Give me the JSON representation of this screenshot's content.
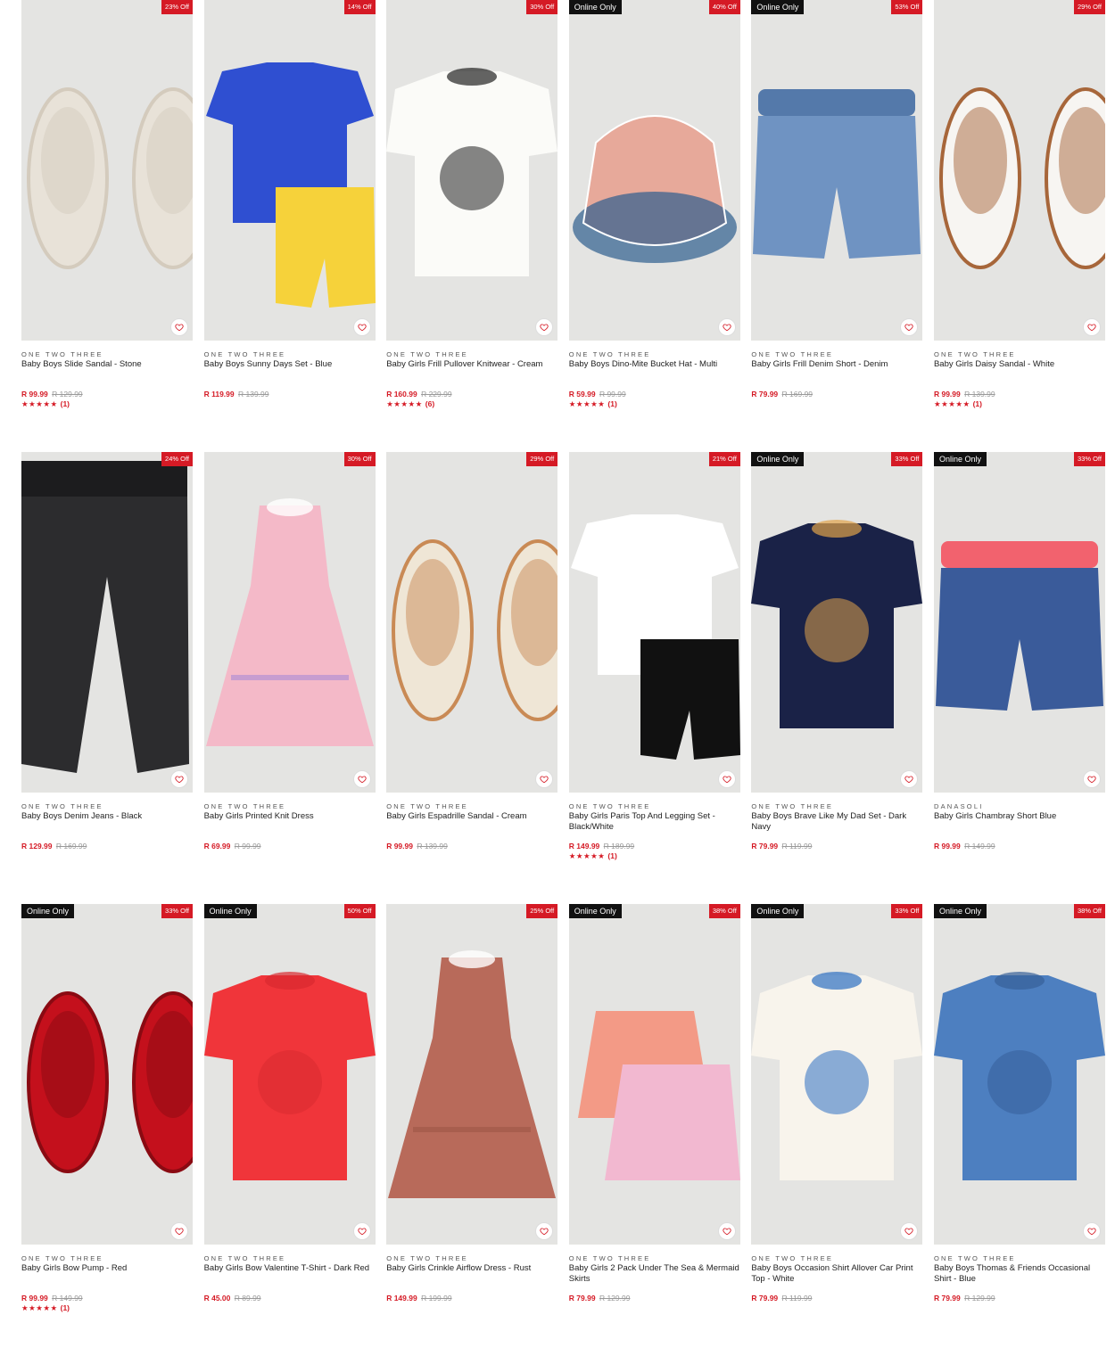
{
  "products": [
    {
      "brand": "ONE TWO THREE",
      "name": "Baby Boys Slide Sandal - Stone",
      "price": "R 99.99",
      "was": "R 129.99",
      "discount": "23% Off",
      "online": "",
      "stars": "★★★★★",
      "reviews": "(1)",
      "icon": "slide-sandal",
      "colors": [
        "#e8e2d8",
        "#d4cbbd"
      ]
    },
    {
      "brand": "ONE TWO THREE",
      "name": "Baby Boys Sunny Days Set - Blue",
      "price": "R 119.99",
      "was": "R 139.99",
      "discount": "14% Off",
      "online": "",
      "stars": "",
      "reviews": "",
      "icon": "tshirt-shorts-set",
      "colors": [
        "#2f4fd1",
        "#f6d23a"
      ]
    },
    {
      "brand": "ONE TWO THREE",
      "name": "Baby Girls Frill Pullover Knitwear - Cream",
      "price": "R 160.99",
      "was": "R 229.99",
      "discount": "30% Off",
      "online": "",
      "stars": "★★★★★",
      "reviews": "(6)",
      "icon": "knit-pullover",
      "colors": [
        "#fbfbf8",
        "#222222"
      ]
    },
    {
      "brand": "ONE TWO THREE",
      "name": "Baby Boys Dino-Mite Bucket Hat - Multi",
      "price": "R 59.99",
      "was": "R 99.99",
      "discount": "40% Off",
      "online": "Online Only",
      "stars": "★★★★★",
      "reviews": "(1)",
      "icon": "bucket-hat",
      "colors": [
        "#e7a99a",
        "#2e5e8f"
      ]
    },
    {
      "brand": "ONE TWO THREE",
      "name": "Baby Girls Frill Denim Short - Denim",
      "price": "R 79.99",
      "was": "R 169.99",
      "discount": "53% Off",
      "online": "Online Only",
      "stars": "",
      "reviews": "",
      "icon": "denim-shorts",
      "colors": [
        "#6f93c2",
        "#5479aa"
      ]
    },
    {
      "brand": "ONE TWO THREE",
      "name": "Baby Girls Daisy Sandal - White",
      "price": "R 99.99",
      "was": "R 139.99",
      "discount": "29% Off",
      "online": "",
      "stars": "★★★★★",
      "reviews": "(1)",
      "icon": "daisy-sandal",
      "colors": [
        "#f7f5f2",
        "#a7663a"
      ]
    },
    {
      "brand": "ONE TWO THREE",
      "name": "Baby Boys Denim Jeans - Black",
      "price": "R 129.99",
      "was": "R 169.99",
      "discount": "24% Off",
      "online": "",
      "stars": "",
      "reviews": "",
      "icon": "jeans",
      "colors": [
        "#2c2c2e",
        "#1c1c1e"
      ]
    },
    {
      "brand": "ONE TWO THREE",
      "name": "Baby Girls Printed Knit Dress",
      "price": "R 69.99",
      "was": "R 99.99",
      "discount": "30% Off",
      "online": "",
      "stars": "",
      "reviews": "",
      "icon": "dress",
      "colors": [
        "#f4b9c8",
        "#a98ad6"
      ]
    },
    {
      "brand": "ONE TWO THREE",
      "name": "Baby Girls Espadrille Sandal - Cream",
      "price": "R 99.99",
      "was": "R 139.99",
      "discount": "29% Off",
      "online": "",
      "stars": "",
      "reviews": "",
      "icon": "espadrille-sandal",
      "colors": [
        "#efe6d6",
        "#c98a55"
      ]
    },
    {
      "brand": "ONE TWO THREE",
      "name": "Baby Girls Paris Top And Legging Set - Black/White",
      "price": "R 149.99",
      "was": "R 189.99",
      "discount": "21% Off",
      "online": "",
      "stars": "★★★★★",
      "reviews": "(1)",
      "icon": "top-legging-set",
      "colors": [
        "#ffffff",
        "#111111"
      ]
    },
    {
      "brand": "ONE TWO THREE",
      "name": "Baby Boys Brave Like My Dad Set - Dark Navy",
      "price": "R 79.99",
      "was": "R 119.99",
      "discount": "33% Off",
      "online": "Online Only",
      "stars": "",
      "reviews": "",
      "icon": "tshirt",
      "colors": [
        "#1a2247",
        "#e0a24a"
      ]
    },
    {
      "brand": "DANASOLI",
      "name": "Baby Girls Chambray Short Blue",
      "price": "R 99.99",
      "was": "R 149.99",
      "discount": "33% Off",
      "online": "Online Only",
      "stars": "",
      "reviews": "",
      "icon": "bow-shorts",
      "colors": [
        "#3a5b9a",
        "#f2626e"
      ]
    },
    {
      "brand": "ONE TWO THREE",
      "name": "Baby Girls Bow Pump - Red",
      "price": "R 99.99",
      "was": "R 149.99",
      "discount": "33% Off",
      "online": "Online Only",
      "stars": "★★★★★",
      "reviews": "(1)",
      "icon": "bow-pump",
      "colors": [
        "#c4101c",
        "#8a0a12"
      ]
    },
    {
      "brand": "ONE TWO THREE",
      "name": "Baby Girls Bow Valentine T-Shirt - Dark Red",
      "price": "R 45.00",
      "was": "R 89.99",
      "discount": "50% Off",
      "online": "Online Only",
      "stars": "",
      "reviews": "",
      "icon": "bow-tshirt",
      "colors": [
        "#f0353a",
        "#d82a2f"
      ]
    },
    {
      "brand": "ONE TWO THREE",
      "name": "Baby Girls Crinkle Airflow Dress - Rust",
      "price": "R 149.99",
      "was": "R 199.99",
      "discount": "25% Off",
      "online": "",
      "stars": "",
      "reviews": "",
      "icon": "ruffle-dress",
      "colors": [
        "#b86a5a",
        "#9d5646"
      ]
    },
    {
      "brand": "ONE TWO THREE",
      "name": "Baby Girls 2 Pack Under The Sea & Mermaid Skirts",
      "price": "R 79.99",
      "was": "R 129.99",
      "discount": "38% Off",
      "online": "Online Only",
      "stars": "",
      "reviews": "",
      "icon": "skirts",
      "colors": [
        "#f39a86",
        "#f2b8d0"
      ]
    },
    {
      "brand": "ONE TWO THREE",
      "name": "Baby Boys Occasion Shirt Allover Car Print Top - White",
      "price": "R 79.99",
      "was": "R 119.99",
      "discount": "33% Off",
      "online": "Online Only",
      "stars": "",
      "reviews": "",
      "icon": "print-shirt",
      "colors": [
        "#f8f4ec",
        "#2e6fc2"
      ]
    },
    {
      "brand": "ONE TWO THREE",
      "name": "Baby Boys Thomas & Friends Occasional Shirt - Blue",
      "price": "R 79.99",
      "was": "R 129.99",
      "discount": "38% Off",
      "online": "Online Only",
      "stars": "",
      "reviews": "",
      "icon": "denim-shirt",
      "colors": [
        "#4d7fc0",
        "#365f99"
      ]
    }
  ],
  "wishlist_icon": "heart-icon",
  "accent": "#d51a25",
  "image_bg": "#e4e4e2"
}
